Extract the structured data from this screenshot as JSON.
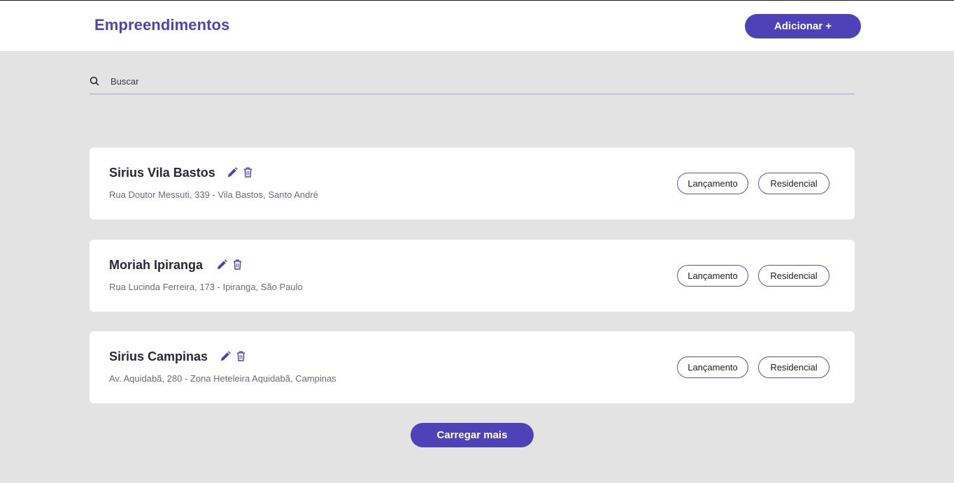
{
  "header": {
    "title": "Empreendimentos",
    "add_label": "Adicionar +"
  },
  "search": {
    "placeholder": "Buscar",
    "icon": "search-icon"
  },
  "cards": [
    {
      "name": "Sirius Vila Bastos",
      "address": "Rua Doutor Messuti, 339 - Vila Bastos, Santo André",
      "tags": [
        "Lançamento",
        "Residencial"
      ]
    },
    {
      "name": "Moriah Ipiranga",
      "address": "Rua Lucinda Ferreira, 173 - Ipiranga, São Paulo",
      "tags": [
        "Lançamento",
        "Residencial"
      ]
    },
    {
      "name": "Sirius Campinas",
      "address": "Av. Aquidabã, 280 - Zona Heteleira Aquidabã, Campinas",
      "tags": [
        "Lançamento",
        "Residencial"
      ]
    }
  ],
  "footer": {
    "load_more_label": "Carregar mais"
  },
  "colors": {
    "accent": "#4f42b8",
    "background": "#e3e3e3",
    "card": "#ffffff"
  }
}
